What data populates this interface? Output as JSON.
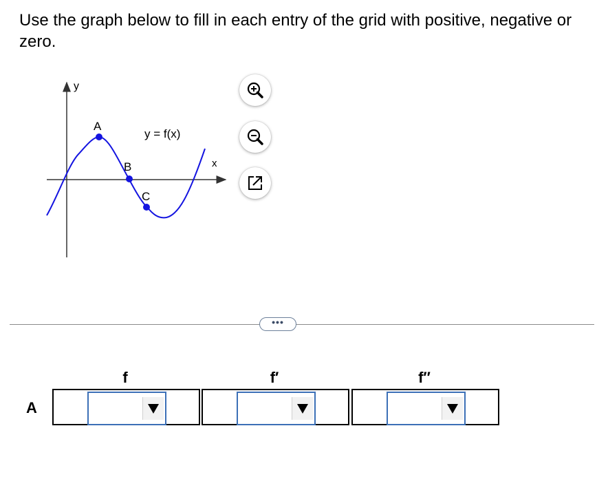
{
  "question": {
    "text": "Use the graph below to fill in each entry of the grid with positive, negative or zero."
  },
  "graph": {
    "y_axis_label": "y",
    "x_axis_label": "x",
    "function_label": "y = f(x)",
    "points": [
      {
        "label": "A"
      },
      {
        "label": "B"
      },
      {
        "label": "C"
      }
    ],
    "curve_color": "#1414e0"
  },
  "toolbar": {
    "zoom_in_icon": "zoom-in-icon",
    "zoom_out_icon": "zoom-out-icon",
    "popout_icon": "popout-icon"
  },
  "more_button": {
    "label": "•••"
  },
  "grid": {
    "columns": [
      "f",
      "f′",
      "f′′"
    ],
    "rows": [
      {
        "label": "A",
        "cells": [
          {
            "value": ""
          },
          {
            "value": ""
          },
          {
            "value": ""
          }
        ]
      }
    ],
    "select_border_color": "#3b6fb6"
  }
}
